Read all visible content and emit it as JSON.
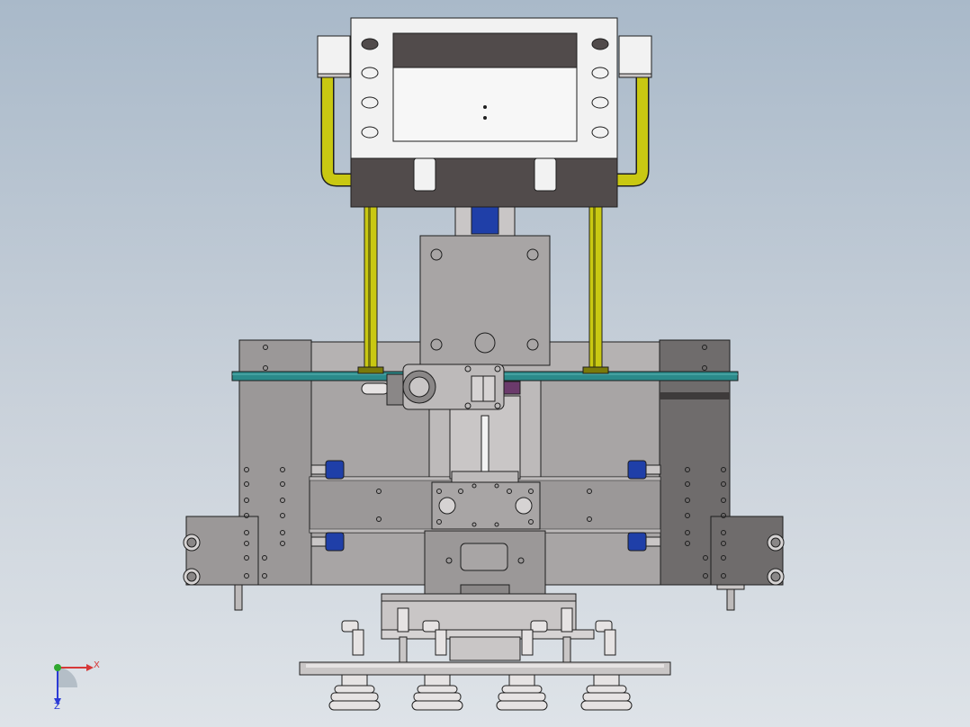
{
  "viewport": {
    "background_top": "#a9b9c9",
    "background_bottom": "#dee3e8"
  },
  "model": {
    "colors": {
      "steel": "#9b9898",
      "steel_dark": "#6f6c6c",
      "steel_light": "#c9c6c6",
      "plate_dark": "#514b4b",
      "handle": "#c9c812",
      "handle_dark": "#7a7a0a",
      "glass": "#2b8a8a",
      "blue_part": "#1f3fa8",
      "purple_part": "#6b3a6b",
      "white_part": "#f2f2f2",
      "outline": "#1e1e1e"
    },
    "components": [
      "control-box",
      "handle-bar",
      "motor-housing",
      "glass-plate",
      "side-frame-left",
      "side-frame-right",
      "cross-beam",
      "vacuum-bar",
      "suction-cups"
    ]
  },
  "triad": {
    "x_label": "X",
    "z_label": "Z",
    "x_color": "#d63838",
    "y_color": "#2fa82f",
    "z_color": "#2b3bd6"
  }
}
